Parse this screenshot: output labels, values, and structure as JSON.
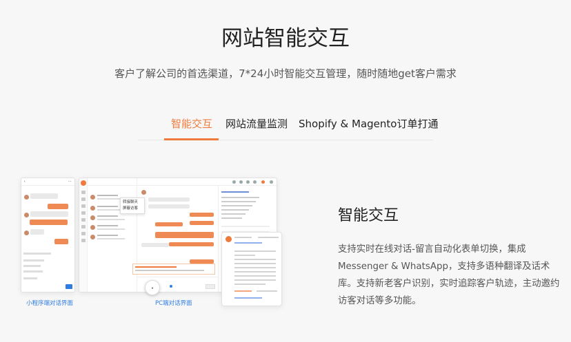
{
  "header": {
    "title": "网站智能交互",
    "subtitle": "客户了解公司的首选渠道，7*24小时智能交互管理，随时随地get客户需求"
  },
  "tabs": [
    {
      "label": "智能交互",
      "active": true
    },
    {
      "label": "网站流量监测",
      "active": false
    },
    {
      "label": "Shopify & Magento订单打通",
      "active": false
    }
  ],
  "feature": {
    "title": "智能交互",
    "description": "支持实时在线对话-留言自动化表单切换，集成Messenger & WhatsApp，支持多语种翻译及话术库。支持新老客户识别，实时追踪客户轨迹，主动邀约访客对话等多功能。"
  },
  "mockups": {
    "phone_caption": "小程序端对话界面",
    "pc_caption": "PC端对话界面",
    "popup_menu": [
      "转接聊天",
      "屏蔽访客"
    ]
  },
  "colors": {
    "accent": "#f07a3c",
    "link": "#2f7de1"
  }
}
